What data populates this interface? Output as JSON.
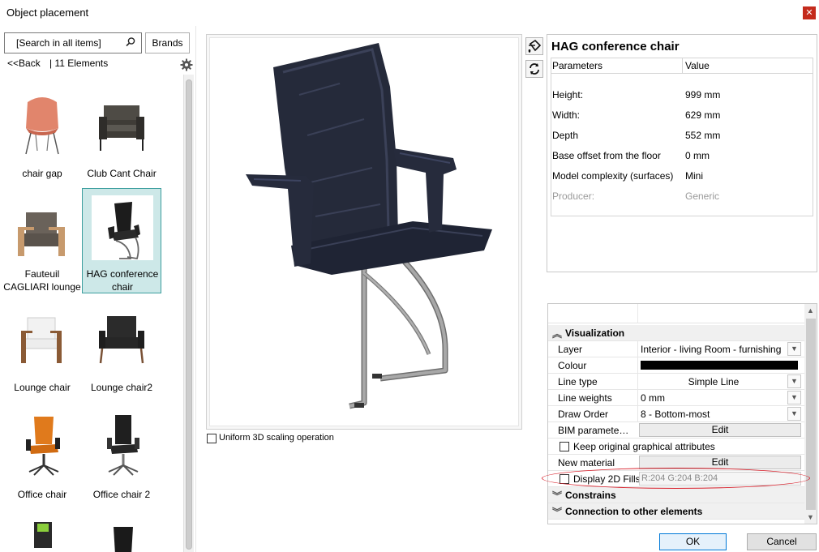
{
  "window": {
    "title": "Object placement",
    "close_icon": "✕"
  },
  "search": {
    "placeholder": "[Search in all items]",
    "brands_label": "Brands"
  },
  "nav": {
    "back_label": "<<Back",
    "count_label": "|  11 Elements"
  },
  "catalog": {
    "items": [
      {
        "label": "chair gap",
        "icon": "shell-chair-pink",
        "selected": false
      },
      {
        "label": "Club Cant Chair",
        "icon": "armchair-dark",
        "selected": false
      },
      {
        "label": "Fauteuil CAGLIARI lounge",
        "icon": "armchair-wood",
        "selected": false
      },
      {
        "label": "HAG conference chair",
        "icon": "conference-chair",
        "selected": true
      },
      {
        "label": "Lounge chair",
        "icon": "lounge-chair-white",
        "selected": false
      },
      {
        "label": "Lounge chair2",
        "icon": "lounge-chair-black",
        "selected": false
      },
      {
        "label": "Office chair",
        "icon": "office-chair-orange",
        "selected": false
      },
      {
        "label": "Office chair 2",
        "icon": "office-chair-black",
        "selected": false
      }
    ]
  },
  "preview": {
    "uniform_scaling_label": "Uniform 3D scaling operation"
  },
  "parameters": {
    "title": "HAG conference chair",
    "header_param": "Parameters",
    "header_value": "Value",
    "rows": [
      {
        "name": "Height:",
        "value": "999 mm"
      },
      {
        "name": "Width:",
        "value": "629 mm"
      },
      {
        "name": "Depth",
        "value": "552 mm"
      },
      {
        "name": "Base offset from the floor",
        "value": "0 mm"
      },
      {
        "name": "Model complexity (surfaces)",
        "value": "Mini"
      },
      {
        "name": "Producer:",
        "value": "Generic"
      }
    ]
  },
  "properties": {
    "visualization_label": "Visualization",
    "layer_label": "Layer",
    "layer_value": "Interior - living Room - furnishing",
    "colour_label": "Colour",
    "colour_value": "#000000",
    "line_type_label": "Line type",
    "line_type_value": "Simple Line",
    "line_weights_label": "Line weights",
    "line_weights_value": "0 mm",
    "draw_order_label": "Draw Order",
    "draw_order_value": "8 - Bottom-most",
    "bim_label": "BIM paramete…",
    "bim_button": "Edit",
    "keep_original_label": "Keep original graphical attributes",
    "new_material_label": "New material",
    "new_material_button": "Edit",
    "display_fills_label": "Display 2D Fills",
    "display_fills_value": "R:204 G:204 B:204",
    "constrains_label": "Constrains",
    "connection_label": "Connection to other elements"
  },
  "buttons": {
    "ok": "OK",
    "cancel": "Cancel"
  },
  "colors": {
    "selection": "#cde8e8",
    "highlight": "#d9232e",
    "accent": "#0078d7"
  }
}
